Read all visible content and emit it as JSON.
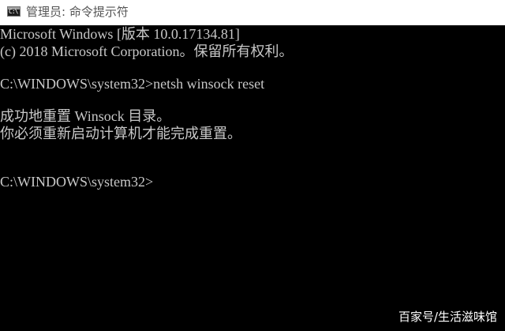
{
  "window": {
    "title": "管理员: 命令提示符",
    "icon": "cmd-console-icon",
    "icon_glyph": "C:\\"
  },
  "console": {
    "lines": [
      "Microsoft Windows [版本 10.0.17134.81]",
      "(c) 2018 Microsoft Corporation。保留所有权利。",
      "",
      "C:\\WINDOWS\\system32>netsh winsock reset",
      "",
      "成功地重置 Winsock 目录。",
      "你必须重新启动计算机才能完成重置。",
      "",
      "",
      "C:\\WINDOWS\\system32>"
    ]
  },
  "watermark": "百家号/生活滋味馆",
  "colors": {
    "titlebar_bg": "#ffffff",
    "title_text": "#555555",
    "console_bg": "#000000",
    "console_text": "#c8c8c8",
    "watermark_text": "#ffffff"
  }
}
